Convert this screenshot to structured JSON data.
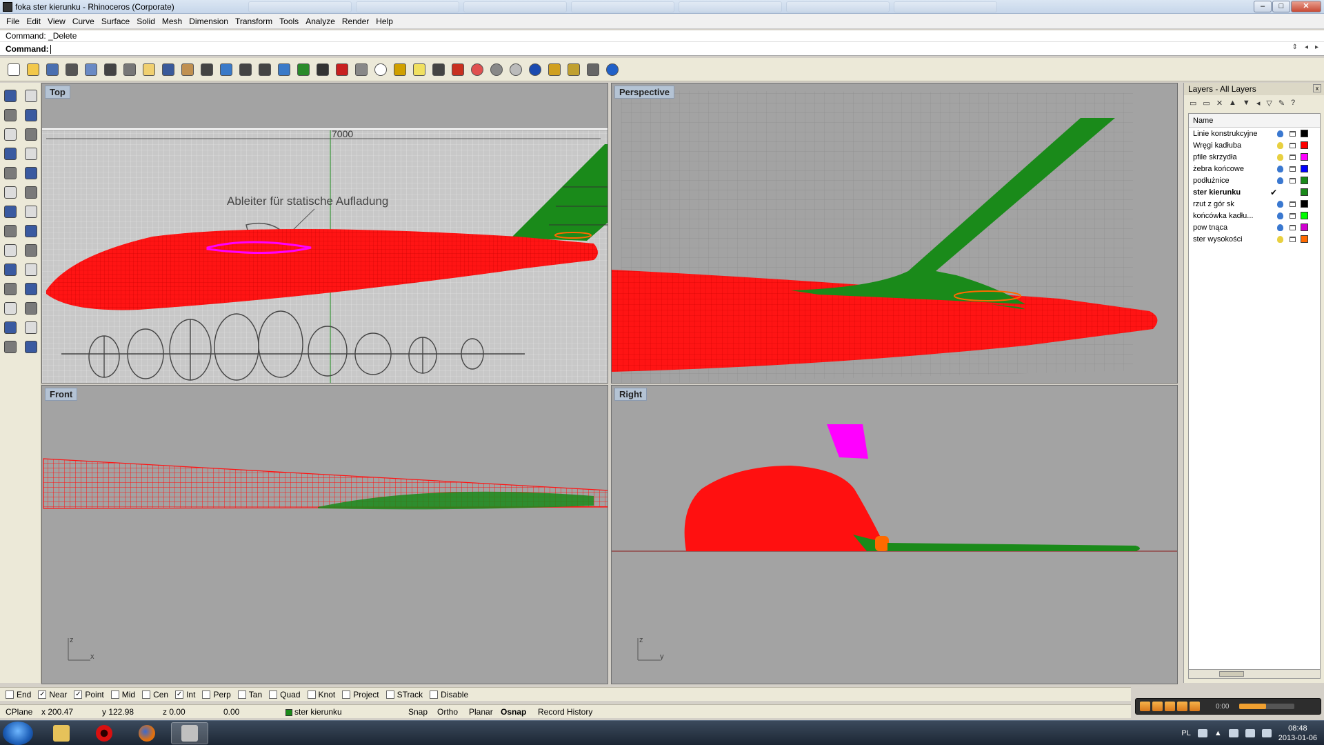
{
  "window": {
    "title": "foka ster kierunku - Rhinoceros (Corporate)",
    "buttons": {
      "minimize": "–",
      "maximize": "□",
      "close": "✕"
    }
  },
  "menu": [
    "File",
    "Edit",
    "View",
    "Curve",
    "Surface",
    "Solid",
    "Mesh",
    "Dimension",
    "Transform",
    "Tools",
    "Analyze",
    "Render",
    "Help"
  ],
  "command": {
    "history": "Command: _Delete",
    "prompt": "Command:"
  },
  "toolbar_icons": [
    "new-icon",
    "open-icon",
    "save-icon",
    "print-icon",
    "export-icon",
    "cut-icon",
    "copy-icon",
    "paste-icon",
    "undo-icon",
    "pan-icon",
    "move-view-icon",
    "zoom-icon",
    "zoom-window-icon",
    "zoom-extents-icon",
    "zoom-selected-icon",
    "rotate-view-icon",
    "four-viewports-icon",
    "car-icon",
    "wireframe-icon",
    "target-icon",
    "point-icon",
    "light-icon",
    "lock-icon",
    "layer-icon",
    "color-wheel-icon",
    "sphere-wire-icon",
    "render-sphere-icon",
    "blue-sphere-icon",
    "flag-icon",
    "settings-icon",
    "grid-icon",
    "help-icon"
  ],
  "toolbar_colors": [
    "#ffffff",
    "#f2c84b",
    "#4a6fb0",
    "#555555",
    "#6a8ac4",
    "#444444",
    "#777777",
    "#f0d070",
    "#3a5a9a",
    "#c09050",
    "#444444",
    "#3a7ac8",
    "#444444",
    "#444444",
    "#3a7ac8",
    "#2a8a2a",
    "#333333",
    "#c82020",
    "#888888",
    "#ffffff",
    "#d0a000",
    "#f0e060",
    "#444444",
    "#c83020",
    "#e05050",
    "#888888",
    "#bbbbbb",
    "#1a4ab0",
    "#d0a020",
    "#c0a030",
    "#666666",
    "#2060c8"
  ],
  "left_tool_icons": [
    "select-arrow-icon",
    "point-tool-icon",
    "polyline-icon",
    "rectangle-icon",
    "circle-icon",
    "arc-icon",
    "ellipse-icon",
    "curve-tool-icon",
    "polygon-icon",
    "fillet-curve-icon",
    "surface-icon",
    "revolve-icon",
    "box-icon",
    "boolean-icon",
    "cylinder-icon",
    "extrude-icon",
    "mesh-tool-icon",
    "deform-icon",
    "transform-icon",
    "align-icon",
    "split-icon",
    "group-icon",
    "text-tool-icon",
    "dimension-tool-icon",
    "array-icon",
    "analyze-tool-icon",
    "render-tool-icon",
    "block-icon"
  ],
  "viewports": {
    "top": {
      "label": "Top",
      "dimension_text": "7000",
      "annotation": "Ableiter für statische Aufladung"
    },
    "perspective": {
      "label": "Perspective"
    },
    "front": {
      "label": "Front",
      "axis_x": "x",
      "axis_z": "z"
    },
    "right": {
      "label": "Right",
      "axis_y": "y",
      "axis_z": "z"
    }
  },
  "colors": {
    "fuselage_red": "#ff1010",
    "fin_green": "#1a8a1a",
    "magenta": "#ff00ff",
    "orange": "#ff6a00",
    "viewport_bg": "#a3a3a3",
    "grid_line": "#949494",
    "viewport_label_bg": "#b4c3d4"
  },
  "layers_panel": {
    "title": "Layers - All Layers",
    "close": "x",
    "column": "Name",
    "toolbar": [
      "new-layer-icon",
      "new-sublayer-icon",
      "delete-layer-icon",
      "move-up-icon",
      "move-down-icon",
      "move-prev-icon",
      "filter-icon",
      "tools-icon",
      "help-icon"
    ],
    "layers": [
      {
        "name": "Linie konstrukcyjne",
        "bulb": "#3a78d0",
        "color": "#000000"
      },
      {
        "name": "Wręgi kadłuba",
        "bulb": "#e8d040",
        "color": "#ff0000"
      },
      {
        "name": "pfile skrzydła",
        "bulb": "#e8d040",
        "color": "#ff00ff"
      },
      {
        "name": "żebra końcowe",
        "bulb": "#3a78d0",
        "color": "#0000ff"
      },
      {
        "name": "podłużnice",
        "bulb": "#3a78d0",
        "color": "#1a8a1a"
      },
      {
        "name": "ster kierunku",
        "current": true,
        "color": "#1a8a1a"
      },
      {
        "name": "rzut z gór sk",
        "bulb": "#3a78d0",
        "color": "#000000"
      },
      {
        "name": "końcówka kadłu...",
        "bulb": "#3a78d0",
        "color": "#00ff00"
      },
      {
        "name": "pow tnąca",
        "bulb": "#3a78d0",
        "color": "#d000d0"
      },
      {
        "name": "ster wysokości",
        "bulb": "#e8d040",
        "color": "#ff6a00"
      }
    ],
    "current_mark": "✔"
  },
  "osnap": [
    {
      "label": "End",
      "checked": false
    },
    {
      "label": "Near",
      "checked": true
    },
    {
      "label": "Point",
      "checked": true
    },
    {
      "label": "Mid",
      "checked": false
    },
    {
      "label": "Cen",
      "checked": false
    },
    {
      "label": "Int",
      "checked": true
    },
    {
      "label": "Perp",
      "checked": false
    },
    {
      "label": "Tan",
      "checked": false
    },
    {
      "label": "Quad",
      "checked": false
    },
    {
      "label": "Knot",
      "checked": false
    },
    {
      "label": "Project",
      "checked": false
    },
    {
      "label": "STrack",
      "checked": false
    },
    {
      "label": "Disable",
      "checked": false
    }
  ],
  "status": {
    "cplane": "CPlane",
    "x": "x 200.47",
    "y": "y 122.98",
    "z": "z 0.00",
    "dist": "0.00",
    "layer": "ster kierunku",
    "snap": "Snap",
    "ortho": "Ortho",
    "planar": "Planar",
    "osnap": "Osnap",
    "record": "Record History"
  },
  "media": {
    "time": "0:00"
  },
  "taskbar": {
    "apps": [
      "windows-explorer-icon",
      "opera-icon",
      "firefox-icon",
      "rhino-icon"
    ],
    "lang": "PL",
    "time": "08:48",
    "date": "2013-01-06"
  }
}
